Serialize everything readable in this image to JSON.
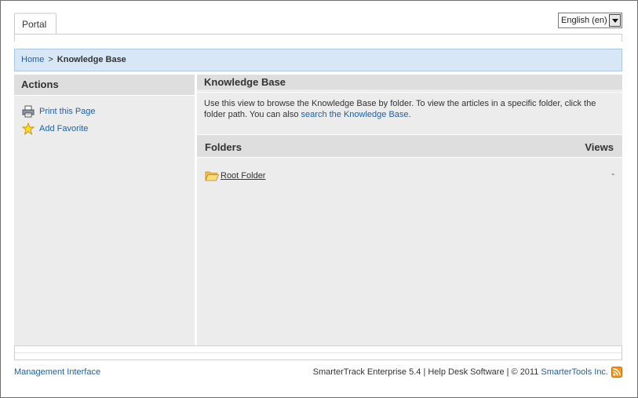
{
  "header": {
    "tab_label": "Portal",
    "language": "English (en)"
  },
  "breadcrumb": {
    "home": "Home",
    "separator": ">",
    "current": "Knowledge Base"
  },
  "actions": {
    "title": "Actions",
    "items": [
      {
        "label": "Print this Page",
        "icon": "printer-icon"
      },
      {
        "label": "Add Favorite",
        "icon": "star-icon"
      }
    ]
  },
  "knowledge_base": {
    "title": "Knowledge Base",
    "description_prefix": "Use this view to browse the Knowledge Base by folder. To view the articles in a specific folder, click the folder path. You can also ",
    "description_link": "search the Knowledge Base",
    "description_suffix": "."
  },
  "folders": {
    "header_label": "Folders",
    "views_label": "Views",
    "rows": [
      {
        "name": "Root Folder",
        "views": "-",
        "icon": "open-folder-icon"
      }
    ]
  },
  "footer": {
    "management_link": "Management Interface",
    "product_text": "SmarterTrack Enterprise 5.4 | Help Desk Software | © 2011 ",
    "company_link": "SmarterTools Inc.",
    "rss_icon": "rss-icon"
  },
  "colors": {
    "link": "#1f5fa8",
    "breadcrumb_bg": "#d8e7f5",
    "panel_bg": "#ececec",
    "panel_header_bg": "#dedede",
    "rss": "#f7931e"
  }
}
